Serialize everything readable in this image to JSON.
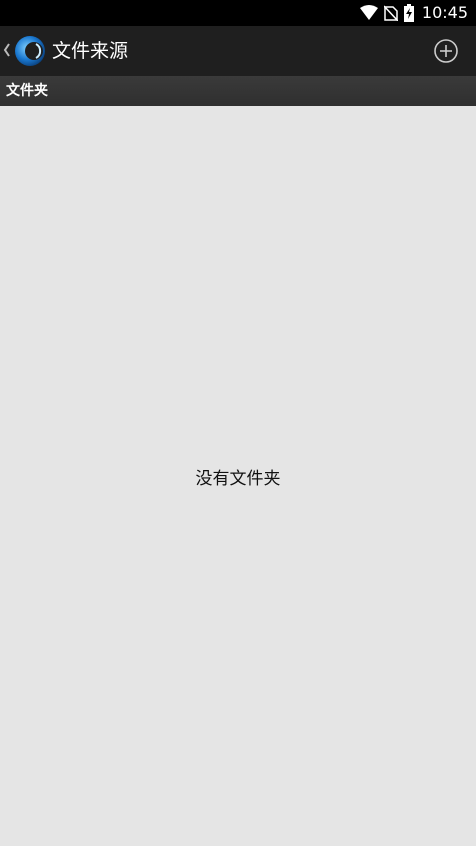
{
  "status_bar": {
    "time": "10:45",
    "icons": [
      "wifi-icon",
      "no-sim-icon",
      "battery-charging-icon"
    ]
  },
  "app_bar": {
    "title": "文件来源",
    "back_icon": "chevron-left-icon",
    "logo_icon": "app-logo-icon",
    "action_icon": "add-circle-icon"
  },
  "section": {
    "title": "文件夹"
  },
  "content": {
    "empty_message": "没有文件夹"
  },
  "colors": {
    "status_bar_bg": "#000000",
    "app_bar_bg": "#1f1f1f",
    "section_header_bg": "#333333",
    "content_bg": "#e5e5e5"
  }
}
